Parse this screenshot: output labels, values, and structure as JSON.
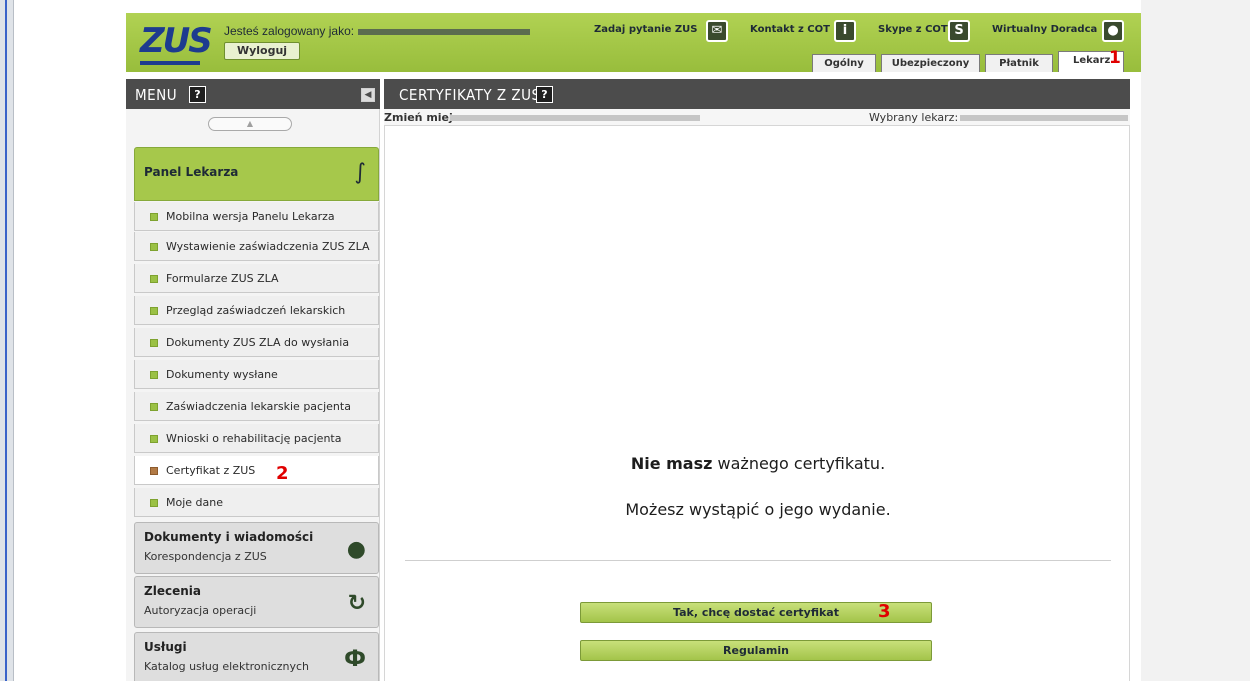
{
  "header": {
    "logo": "ZUS",
    "logged_in_label": "Jesteś zalogowany jako:",
    "logout_label": "Wyloguj",
    "links": [
      {
        "label": "Zadaj pytanie ZUS",
        "icon": "chat-icon"
      },
      {
        "label": "Kontakt z COT",
        "icon": "info-icon"
      },
      {
        "label": "Skype z COT",
        "icon": "skype-icon"
      },
      {
        "label": "Wirtualny Doradca",
        "icon": "person-icon"
      }
    ],
    "tabs": [
      {
        "label": "Ogólny",
        "active": false
      },
      {
        "label": "Ubezpieczony",
        "active": false
      },
      {
        "label": "Płatnik",
        "active": false
      },
      {
        "label": "Lekarz",
        "active": true
      }
    ]
  },
  "markers": [
    "1",
    "2",
    "3"
  ],
  "menu": {
    "title": "MENU",
    "help": "?",
    "panel_title": "Panel Lekarza",
    "items": [
      {
        "label": "Mobilna wersja Panelu Lekarza",
        "active": false
      },
      {
        "label": "Wystawienie zaświadczenia ZUS ZLA",
        "active": false
      },
      {
        "label": "Formularze ZUS ZLA",
        "active": false
      },
      {
        "label": "Przegląd zaświadczeń lekarskich",
        "active": false
      },
      {
        "label": "Dokumenty ZUS ZLA do wysłania",
        "active": false
      },
      {
        "label": "Dokumenty wysłane",
        "active": false
      },
      {
        "label": "Zaświadczenia lekarskie pacjenta",
        "active": false
      },
      {
        "label": "Wnioski o rehabilitację pacjenta",
        "active": false
      },
      {
        "label": "Certyfikat z ZUS",
        "active": true
      },
      {
        "label": "Moje dane",
        "active": false
      }
    ],
    "sections": [
      {
        "title": "Dokumenty i wiadomości",
        "subtitle": "Korespondencja z ZUS",
        "icon": "speech-bubble-icon"
      },
      {
        "title": "Zlecenia",
        "subtitle": "Autoryzacja operacji",
        "icon": "refresh-icon"
      },
      {
        "title": "Usługi",
        "subtitle": "Katalog usług elektronicznych",
        "icon": "services-icon"
      }
    ]
  },
  "content": {
    "title": "CERTYFIKATY Z ZUS",
    "help": "?",
    "change_place_label": "Zmień miejsce:",
    "selected_doctor_label": "Wybrany lekarz:",
    "message_bold": "Nie masz",
    "message_rest": " ważnego certyfikatu.",
    "message2": "Możesz wystąpić o jego wydanie.",
    "primary_button": "Tak, chcę dostać certyfikat",
    "secondary_button": "Regulamin"
  },
  "colors": {
    "brand_green": "#a6c84b",
    "brand_blue": "#1d3b8f",
    "header_dark": "#4c4c4c",
    "marker_red": "#e00000"
  }
}
